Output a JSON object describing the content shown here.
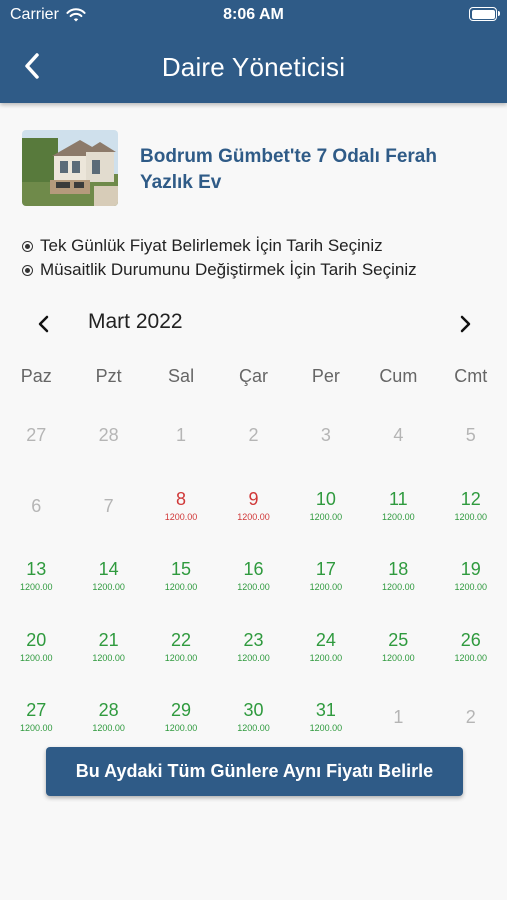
{
  "status_bar": {
    "carrier": "Carrier",
    "time": "8:06 AM"
  },
  "header": {
    "title": "Daire Yöneticisi",
    "back_icon": "chevron-left-icon"
  },
  "property": {
    "title": "Bodrum Gümbet'te 7 Odalı Ferah Yazlık Ev"
  },
  "instructions": [
    "Tek Günlük Fiyat Belirlemek İçin Tarih Seçiniz",
    "Müsaitlik Durumunu Değiştirmek İçin Tarih Seçiniz"
  ],
  "calendar": {
    "month_label": "Mart 2022",
    "weekdays": [
      "Paz",
      "Pzt",
      "Sal",
      "Çar",
      "Per",
      "Cum",
      "Cmt"
    ],
    "weeks": [
      [
        {
          "day": "27",
          "price": "",
          "state": "muted"
        },
        {
          "day": "28",
          "price": "",
          "state": "muted"
        },
        {
          "day": "1",
          "price": "",
          "state": "muted"
        },
        {
          "day": "2",
          "price": "",
          "state": "muted"
        },
        {
          "day": "3",
          "price": "",
          "state": "muted"
        },
        {
          "day": "4",
          "price": "",
          "state": "muted"
        },
        {
          "day": "5",
          "price": "",
          "state": "muted"
        }
      ],
      [
        {
          "day": "6",
          "price": "",
          "state": "muted"
        },
        {
          "day": "7",
          "price": "",
          "state": "muted"
        },
        {
          "day": "8",
          "price": "1200.00",
          "state": "red"
        },
        {
          "day": "9",
          "price": "1200.00",
          "state": "red"
        },
        {
          "day": "10",
          "price": "1200.00",
          "state": "green"
        },
        {
          "day": "11",
          "price": "1200.00",
          "state": "green"
        },
        {
          "day": "12",
          "price": "1200.00",
          "state": "green"
        }
      ],
      [
        {
          "day": "13",
          "price": "1200.00",
          "state": "green"
        },
        {
          "day": "14",
          "price": "1200.00",
          "state": "green"
        },
        {
          "day": "15",
          "price": "1200.00",
          "state": "green"
        },
        {
          "day": "16",
          "price": "1200.00",
          "state": "green"
        },
        {
          "day": "17",
          "price": "1200.00",
          "state": "green"
        },
        {
          "day": "18",
          "price": "1200.00",
          "state": "green"
        },
        {
          "day": "19",
          "price": "1200.00",
          "state": "green"
        }
      ],
      [
        {
          "day": "20",
          "price": "1200.00",
          "state": "green"
        },
        {
          "day": "21",
          "price": "1200.00",
          "state": "green"
        },
        {
          "day": "22",
          "price": "1200.00",
          "state": "green"
        },
        {
          "day": "23",
          "price": "1200.00",
          "state": "green"
        },
        {
          "day": "24",
          "price": "1200.00",
          "state": "green"
        },
        {
          "day": "25",
          "price": "1200.00",
          "state": "green"
        },
        {
          "day": "26",
          "price": "1200.00",
          "state": "green"
        }
      ],
      [
        {
          "day": "27",
          "price": "1200.00",
          "state": "green"
        },
        {
          "day": "28",
          "price": "1200.00",
          "state": "green"
        },
        {
          "day": "29",
          "price": "1200.00",
          "state": "green"
        },
        {
          "day": "30",
          "price": "1200.00",
          "state": "green"
        },
        {
          "day": "31",
          "price": "1200.00",
          "state": "green"
        },
        {
          "day": "1",
          "price": "",
          "state": "muted"
        },
        {
          "day": "2",
          "price": "",
          "state": "muted"
        }
      ]
    ]
  },
  "cta": {
    "label": "Bu Aydaki Tüm Günlere Aynı Fiyatı Belirle"
  },
  "colors": {
    "primary": "#2f5b87",
    "available": "#2f9a3e",
    "unavailable": "#d03838",
    "muted": "#b5b5b5"
  }
}
